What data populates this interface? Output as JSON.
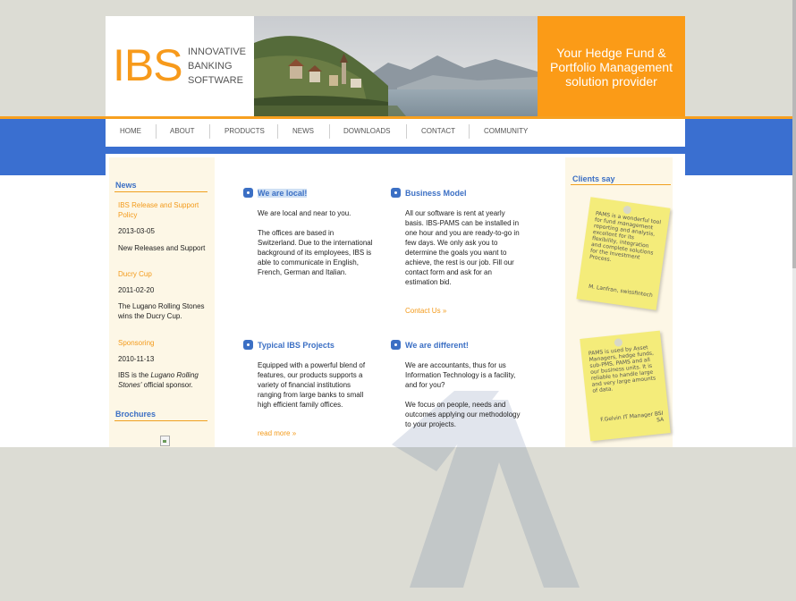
{
  "header": {
    "logo_main": "IBS",
    "logo_line1": "INNOVATIVE",
    "logo_line2": "BANKING",
    "logo_line3": "SOFTWARE",
    "slogan_line1": "Your Hedge Fund &",
    "slogan_line2": "Portfolio Management",
    "slogan_line3": "solution provider"
  },
  "nav": {
    "items": [
      "HOME",
      "ABOUT",
      "PRODUCTS",
      "NEWS",
      "DOWNLOADS",
      "CONTACT",
      "COMMUNITY"
    ]
  },
  "left": {
    "news_title": "News",
    "items": [
      {
        "text": "IBS Release and Support Policy",
        "style": "orange"
      },
      {
        "text": "2013-03-05",
        "style": "dark"
      },
      {
        "text": "New Releases and Support",
        "style": "dark"
      },
      {
        "text": "Ducry Cup",
        "style": "orange"
      },
      {
        "text": "2011-02-20",
        "style": "dark"
      },
      {
        "text": "The Lugano Rolling Stones wins the Ducry Cup.",
        "style": "dark"
      },
      {
        "text": "Sponsoring",
        "style": "orange"
      },
      {
        "text": "2010-11-13",
        "style": "dark"
      },
      {
        "text_pre": "IBS is the ",
        "text_italic": "Lugano Rolling Stones'",
        "text_post": " official sponsor.",
        "style": "dark"
      }
    ],
    "brochures_title": "Brochures"
  },
  "center": {
    "block1": {
      "title": "We are local!",
      "p1": "We are local and near to you.",
      "p2": "The offices are based in Switzerland. Due to the international background of its employees, IBS is able to communicate in English, French, German and Italian."
    },
    "block2": {
      "title": "Business Model",
      "p1": "All our software is rent at yearly basis. IBS-PAMS can be installed in one hour and you are ready-to-go in few days. We only ask you to determine the goals you want to achieve, the rest is our job. Fill our contact form and ask for an estimation bid.",
      "link": "Contact Us"
    },
    "block3": {
      "title": "Typical IBS Projects",
      "p1": "Equipped with a powerful blend of features, our products supports a variety of financial institutions ranging from large banks to small high efficient family offices.",
      "link": "read more"
    },
    "block4": {
      "title": "We are different!",
      "p1": "We are accountants, thus for us Information Technology is a facility, and for you?",
      "p2": "We focus on people, needs and outcomes applying our methodology to your projects."
    }
  },
  "right": {
    "title": "Clients say",
    "note1_text": "PAMS is a wonderful tool for fund management reporting and analysis, excellent for its flexibility, integration and complete solutions for the Investment Process.",
    "note1_sign": "M. Lanfran, swissfintech",
    "note2_text": "PAMS is used by Asset Managers, hedge funds, sub-PMS, PAMS and all our business units. It is reliable to handle large and very large amounts of data.",
    "note2_sign": "F.Gelvin IT Manager BSI SA"
  },
  "colors": {
    "orange": "#f79a1b",
    "blue": "#3a6fd0",
    "heading_blue": "#3b6fc4"
  }
}
